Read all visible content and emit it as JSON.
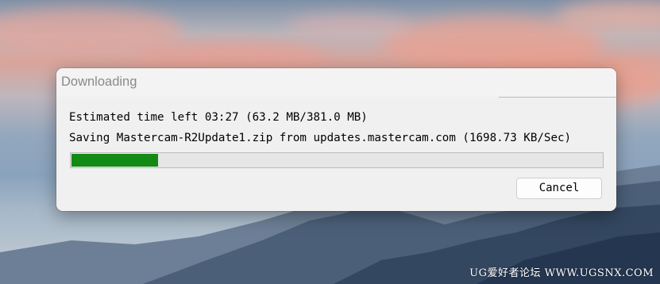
{
  "dialog": {
    "title": "Downloading",
    "estimated_line": "Estimated time left 03:27 (63.2 MB/381.0 MB)",
    "saving_line": "Saving Mastercam-R2Update1.zip from updates.mastercam.com (1698.73 KB/Sec)",
    "progress_fraction": 0.166,
    "progress_color": "#138a13",
    "cancel_label": "Cancel"
  },
  "desktop": {
    "watermark": "UG爱好者论坛 WWW.UGSNX.COM"
  }
}
